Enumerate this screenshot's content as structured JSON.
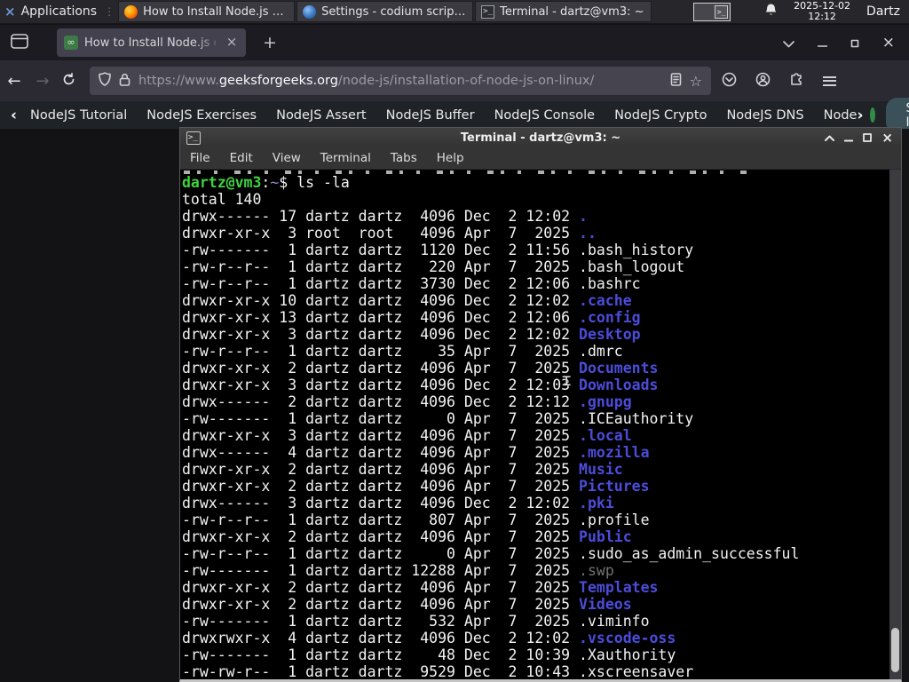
{
  "panel": {
    "applications_label": "Applications",
    "windows": [
      {
        "title": "How to Install Node.js o...",
        "icon": "firefox-icon"
      },
      {
        "title": "Settings - codium script...",
        "icon": "vscodium-icon"
      },
      {
        "title": "Terminal - dartz@vm3: ~",
        "icon": "terminal-icon"
      }
    ],
    "clock_date": "2025-12-02",
    "clock_time": "12:12",
    "user": "Dartz"
  },
  "browser": {
    "tab_title": "How to Install Node.js on",
    "tab_close_glyph": "×",
    "new_tab_label": "+",
    "url_scheme": "https://www.",
    "url_host": "geeksforgeeks.org",
    "url_path": "/node-js/installation-of-node-js-on-linux/",
    "star_glyph": "☆"
  },
  "site_nav": {
    "back_chevron": "‹",
    "items": [
      "NodeJS Tutorial",
      "NodeJS Exercises",
      "NodeJS Assert",
      "NodeJS Buffer",
      "NodeJS Console",
      "NodeJS Crypto",
      "NodeJS DNS",
      "Node"
    ],
    "more_chevron": "›",
    "sign_in_label": "Sign In",
    "accent_green": "#2f8d46"
  },
  "terminal_window": {
    "title": "Terminal - dartz@vm3: ~",
    "menu": [
      "File",
      "Edit",
      "View",
      "Terminal",
      "Tabs",
      "Help"
    ],
    "prompt_user": "dartz@vm3",
    "prompt_separator": ":",
    "prompt_path": "~",
    "prompt_symbol": "$ ",
    "command": "ls -la",
    "total_line": "total 140",
    "colors": {
      "directory": "#4c4cda",
      "text": "#f3f3f3",
      "prompt_green": "#3fd23f",
      "dim": "#737373"
    },
    "rows": [
      {
        "perms": "drwx------",
        "links": "17",
        "owner": "dartz",
        "group": "dartz",
        "size": "4096",
        "date": "Dec  2 12:02",
        "name": ".",
        "type": "dir"
      },
      {
        "perms": "drwxr-xr-x",
        "links": "3",
        "owner": "root",
        "group": "root",
        "size": "4096",
        "date": "Apr  7  2025",
        "name": "..",
        "type": "dir"
      },
      {
        "perms": "-rw-------",
        "links": "1",
        "owner": "dartz",
        "group": "dartz",
        "size": "1120",
        "date": "Dec  2 11:56",
        "name": ".bash_history",
        "type": "file"
      },
      {
        "perms": "-rw-r--r--",
        "links": "1",
        "owner": "dartz",
        "group": "dartz",
        "size": "220",
        "date": "Apr  7  2025",
        "name": ".bash_logout",
        "type": "file"
      },
      {
        "perms": "-rw-r--r--",
        "links": "1",
        "owner": "dartz",
        "group": "dartz",
        "size": "3730",
        "date": "Dec  2 12:06",
        "name": ".bashrc",
        "type": "file"
      },
      {
        "perms": "drwxr-xr-x",
        "links": "10",
        "owner": "dartz",
        "group": "dartz",
        "size": "4096",
        "date": "Dec  2 12:02",
        "name": ".cache",
        "type": "dir"
      },
      {
        "perms": "drwxr-xr-x",
        "links": "13",
        "owner": "dartz",
        "group": "dartz",
        "size": "4096",
        "date": "Dec  2 12:06",
        "name": ".config",
        "type": "dir"
      },
      {
        "perms": "drwxr-xr-x",
        "links": "3",
        "owner": "dartz",
        "group": "dartz",
        "size": "4096",
        "date": "Dec  2 12:02",
        "name": "Desktop",
        "type": "dir"
      },
      {
        "perms": "-rw-r--r--",
        "links": "1",
        "owner": "dartz",
        "group": "dartz",
        "size": "35",
        "date": "Apr  7  2025",
        "name": ".dmrc",
        "type": "file"
      },
      {
        "perms": "drwxr-xr-x",
        "links": "2",
        "owner": "dartz",
        "group": "dartz",
        "size": "4096",
        "date": "Apr  7  2025",
        "name": "Documents",
        "type": "dir"
      },
      {
        "perms": "drwxr-xr-x",
        "links": "3",
        "owner": "dartz",
        "group": "dartz",
        "size": "4096",
        "date": "Dec  2 12:03",
        "name": "Downloads",
        "type": "dir"
      },
      {
        "perms": "drwx------",
        "links": "2",
        "owner": "dartz",
        "group": "dartz",
        "size": "4096",
        "date": "Dec  2 12:12",
        "name": ".gnupg",
        "type": "dir"
      },
      {
        "perms": "-rw-------",
        "links": "1",
        "owner": "dartz",
        "group": "dartz",
        "size": "0",
        "date": "Apr  7  2025",
        "name": ".ICEauthority",
        "type": "file"
      },
      {
        "perms": "drwxr-xr-x",
        "links": "3",
        "owner": "dartz",
        "group": "dartz",
        "size": "4096",
        "date": "Apr  7  2025",
        "name": ".local",
        "type": "dir"
      },
      {
        "perms": "drwx------",
        "links": "4",
        "owner": "dartz",
        "group": "dartz",
        "size": "4096",
        "date": "Apr  7  2025",
        "name": ".mozilla",
        "type": "dir"
      },
      {
        "perms": "drwxr-xr-x",
        "links": "2",
        "owner": "dartz",
        "group": "dartz",
        "size": "4096",
        "date": "Apr  7  2025",
        "name": "Music",
        "type": "dir"
      },
      {
        "perms": "drwxr-xr-x",
        "links": "2",
        "owner": "dartz",
        "group": "dartz",
        "size": "4096",
        "date": "Apr  7  2025",
        "name": "Pictures",
        "type": "dir"
      },
      {
        "perms": "drwx------",
        "links": "3",
        "owner": "dartz",
        "group": "dartz",
        "size": "4096",
        "date": "Dec  2 12:02",
        "name": ".pki",
        "type": "dir"
      },
      {
        "perms": "-rw-r--r--",
        "links": "1",
        "owner": "dartz",
        "group": "dartz",
        "size": "807",
        "date": "Apr  7  2025",
        "name": ".profile",
        "type": "file"
      },
      {
        "perms": "drwxr-xr-x",
        "links": "2",
        "owner": "dartz",
        "group": "dartz",
        "size": "4096",
        "date": "Apr  7  2025",
        "name": "Public",
        "type": "dir"
      },
      {
        "perms": "-rw-r--r--",
        "links": "1",
        "owner": "dartz",
        "group": "dartz",
        "size": "0",
        "date": "Apr  7  2025",
        "name": ".sudo_as_admin_successful",
        "type": "file"
      },
      {
        "perms": "-rw-------",
        "links": "1",
        "owner": "dartz",
        "group": "dartz",
        "size": "12288",
        "date": "Apr  7  2025",
        "name": ".swp",
        "type": "dim"
      },
      {
        "perms": "drwxr-xr-x",
        "links": "2",
        "owner": "dartz",
        "group": "dartz",
        "size": "4096",
        "date": "Apr  7  2025",
        "name": "Templates",
        "type": "dir"
      },
      {
        "perms": "drwxr-xr-x",
        "links": "2",
        "owner": "dartz",
        "group": "dartz",
        "size": "4096",
        "date": "Apr  7  2025",
        "name": "Videos",
        "type": "dir"
      },
      {
        "perms": "-rw-------",
        "links": "1",
        "owner": "dartz",
        "group": "dartz",
        "size": "532",
        "date": "Apr  7  2025",
        "name": ".viminfo",
        "type": "file"
      },
      {
        "perms": "drwxrwxr-x",
        "links": "4",
        "owner": "dartz",
        "group": "dartz",
        "size": "4096",
        "date": "Dec  2 12:02",
        "name": ".vscode-oss",
        "type": "dir"
      },
      {
        "perms": "-rw-------",
        "links": "1",
        "owner": "dartz",
        "group": "dartz",
        "size": "48",
        "date": "Dec  2 10:39",
        "name": ".Xauthority",
        "type": "file"
      },
      {
        "perms": "-rw-rw-r--",
        "links": "1",
        "owner": "dartz",
        "group": "dartz",
        "size": "9529",
        "date": "Dec  2 10:43",
        "name": ".xscreensaver",
        "type": "file"
      }
    ]
  }
}
